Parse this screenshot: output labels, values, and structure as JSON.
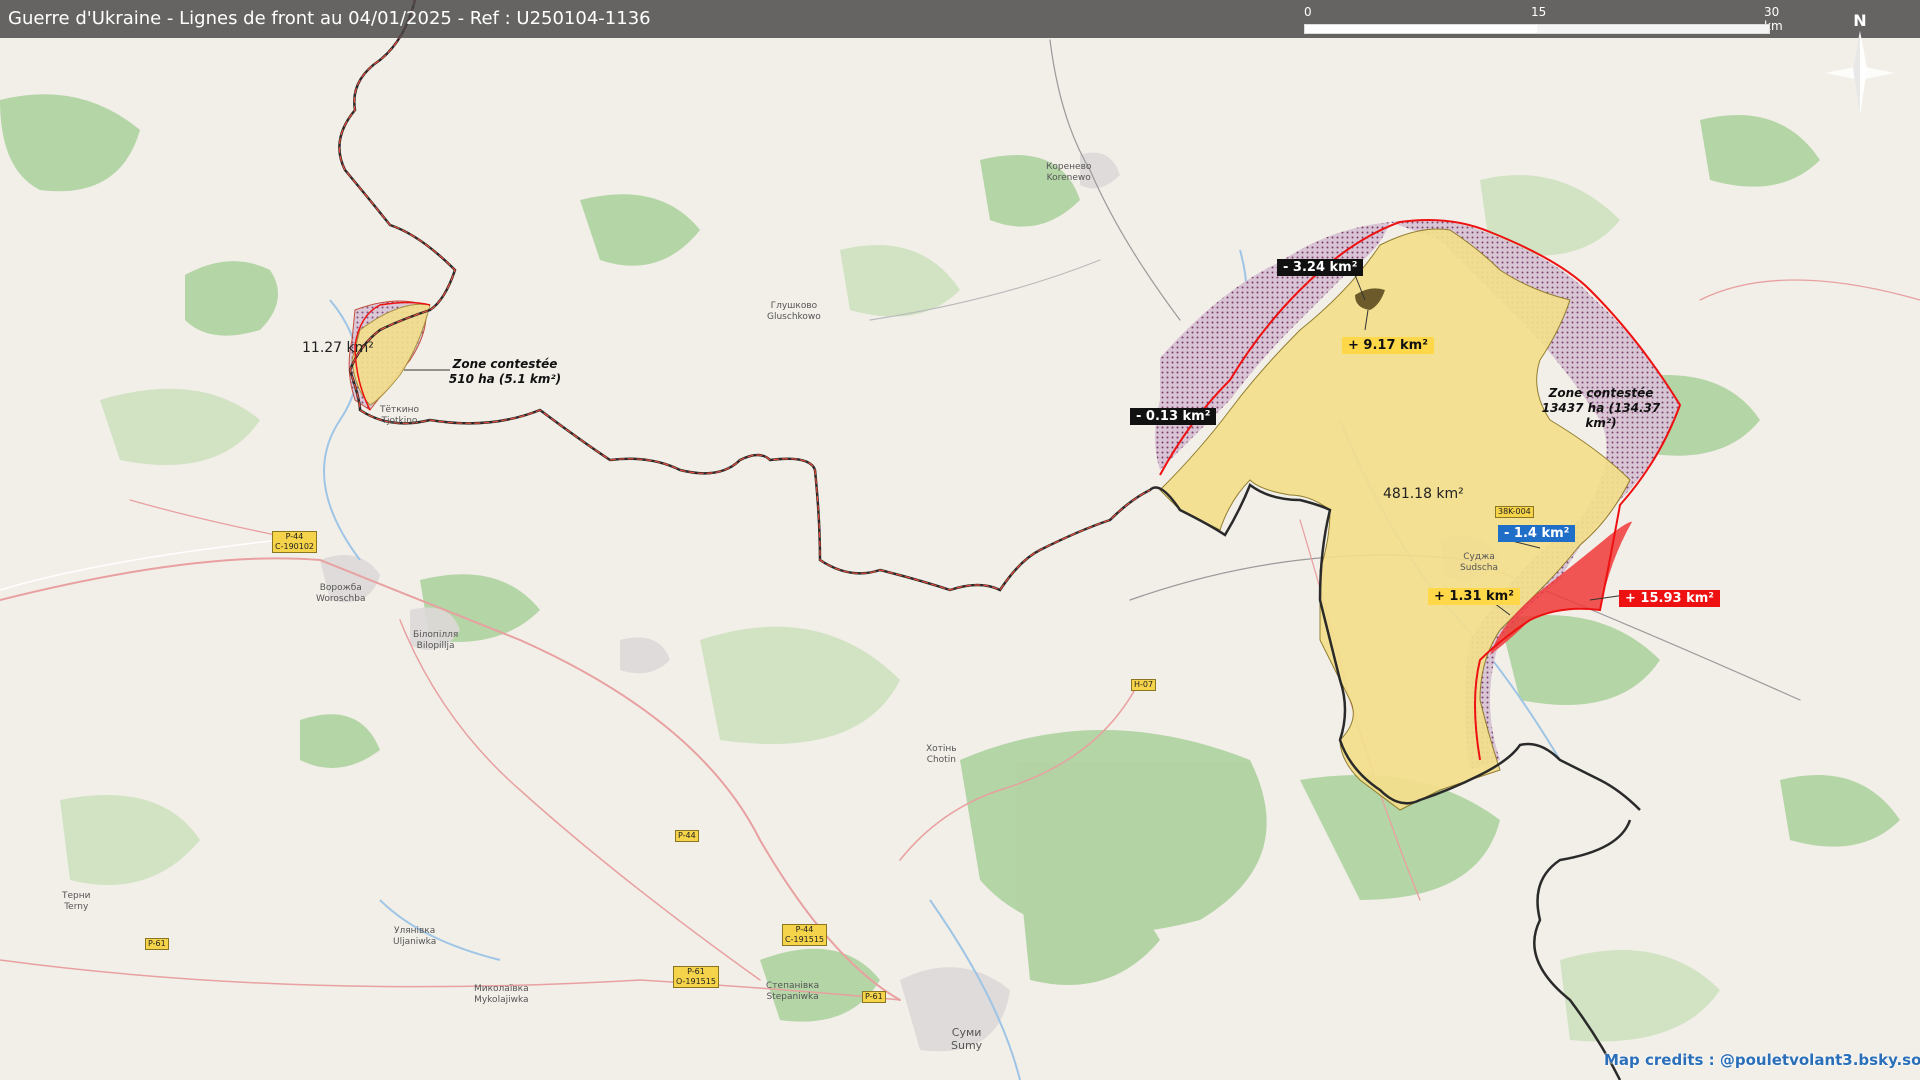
{
  "title": "Guerre d'Ukraine - Lignes de front au 04/01/2025 - Ref : U250104-1136",
  "scale": {
    "labels": [
      "0",
      "15",
      "30 km"
    ]
  },
  "compass": {
    "label": "N"
  },
  "colors": {
    "occupied": "#f4df8c",
    "contested": "#c9a9c4",
    "gain": "#f03a3a",
    "border": "#c0392b"
  },
  "change_labels": {
    "minus_3_24": "- 3.24 km²",
    "plus_9_17": "+ 9.17 km²",
    "minus_0_13": "- 0.13 km²",
    "minus_1_4": "- 1.4 km²",
    "plus_1_31": "+ 1.31 km²",
    "plus_15_93": "+ 15.93 km²"
  },
  "areas": {
    "main": "481.18 km²",
    "small": "11.27 km²"
  },
  "zones": {
    "west_title": "Zone contestée",
    "west_value": "510 ha (5.1 km²)",
    "east_title": "Zone contestée",
    "east_value": "13437 ha (134.37 km²)"
  },
  "towns": {
    "korenevo": "Коренево\nKorenewo",
    "glushkovo": "Глушково\nGluschkowo",
    "tyotkino": "Тёткино\nTjotkino",
    "vorozhba": "Ворожба\nWoroschba",
    "bilopillia": "Білопілля\nBilopillja",
    "sudzha": "Суджа\nSudscha",
    "khotin": "Хотінь\nChotin",
    "terny": "Терни\nTerny",
    "ulianivka": "Улянівка\nUljaniwka",
    "mykolaivka": "Миколаївка\nMykolajiwka",
    "stepanivka": "Степанівка\nStepaniwka",
    "sumy": "Суми\nSumy"
  },
  "roads": {
    "p44a": "P-44\nC-190102",
    "h07": "H-07",
    "p44b": "P-44",
    "p44c": "P-44\nC-191515",
    "p61a": "P-61",
    "p61b": "P-61\nO-191515",
    "p61c": "P-61",
    "r38k": "38K-004"
  },
  "credits": "Map credits : @pouletvolant3.bsky.social"
}
